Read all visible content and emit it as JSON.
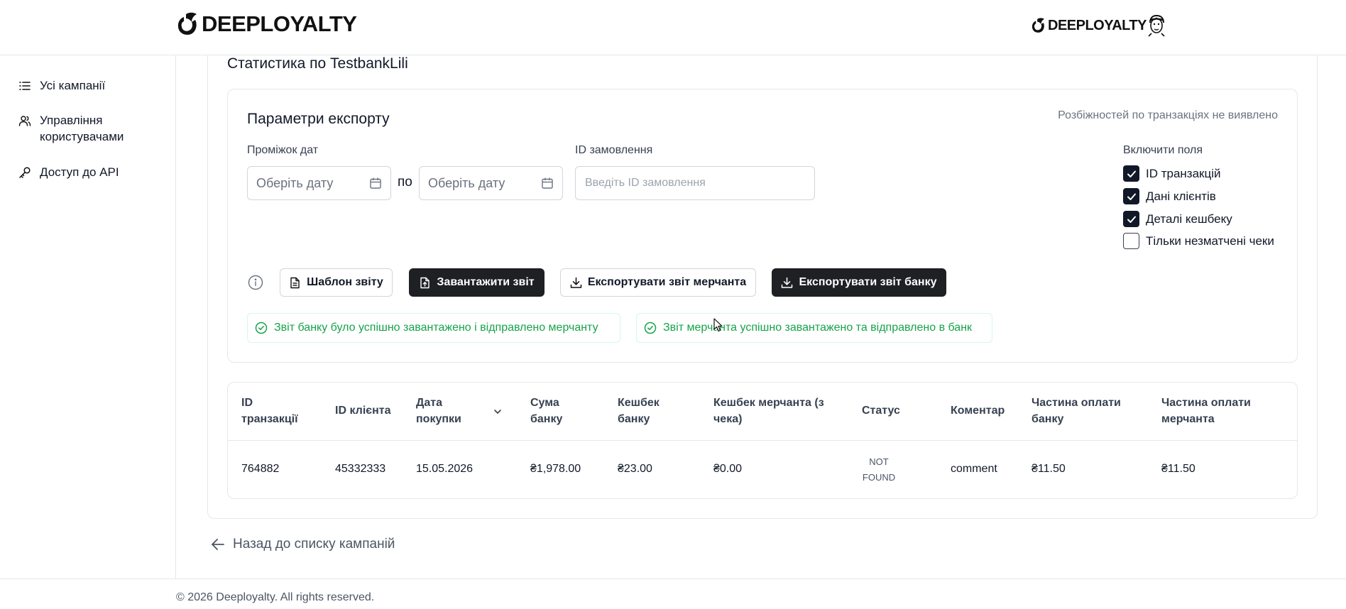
{
  "header": {
    "logo_text": "DEEPLOYALTY",
    "partner_logo_text": "DEEPLOYALTY"
  },
  "sidebar": {
    "items": [
      {
        "label": "Усі кампанії",
        "icon": "list-icon"
      },
      {
        "label": "Управління користувачами",
        "icon": "users-icon"
      },
      {
        "label": "Доступ до API",
        "icon": "key-icon"
      }
    ]
  },
  "page": {
    "title": "Статистика по TestbankLili"
  },
  "export": {
    "title": "Параметри експорту",
    "discrepancy_text": "Розбіжностей по транзакціях не виявлено",
    "date_range_label": "Проміжок дат",
    "date_from_placeholder": "Оберіть дату",
    "date_separator": "по",
    "date_to_placeholder": "Оберіть дату",
    "order_id_label": "ID замовлення",
    "order_id_placeholder": "Введіть ID замовлення",
    "include_fields_label": "Включити поля",
    "fields": [
      {
        "label": "ID транзакцій",
        "checked": true
      },
      {
        "label": "Дані клієнтів",
        "checked": true
      },
      {
        "label": "Деталі кешбеку",
        "checked": true
      },
      {
        "label": "Тільки незматчені чеки",
        "checked": false
      }
    ],
    "buttons": {
      "template": "Шаблон звіту",
      "upload": "Завантажити звіт",
      "export_merchant": "Експортувати звіт мерчанта",
      "export_bank": "Експортувати звіт банку"
    },
    "toasts": {
      "bank": "Звіт банку було успішно завантажено і відправлено мерчанту",
      "merchant": "Звіт мерчанта успішно завантажено та відправлено в банк"
    }
  },
  "table": {
    "headers": [
      "ID транзакції",
      "ID клієнта",
      "Дата покупки",
      "Сума банку",
      "Кешбек банку",
      "Кешбек мерчанта (з чека)",
      "Статус",
      "Коментар",
      "Частина оплати банку",
      "Частина оплати мерчанта"
    ],
    "rows": [
      {
        "transaction_id": "764882",
        "client_id": "45332333",
        "purchase_date": "15.05.2026",
        "bank_amount": "₴1,978.00",
        "bank_cashback": "₴23.00",
        "merchant_cashback": "₴0.00",
        "status": "NOT FOUND",
        "comment": "comment",
        "bank_share": "₴11.50",
        "merchant_share": "₴11.50"
      }
    ]
  },
  "back_link": "Назад до списку кампаній",
  "footer": "© 2026 Deeployalty. All rights reserved.",
  "colors": {
    "dark_button": "#1f2023",
    "success": "#16a34a",
    "border": "#e5e7eb"
  }
}
